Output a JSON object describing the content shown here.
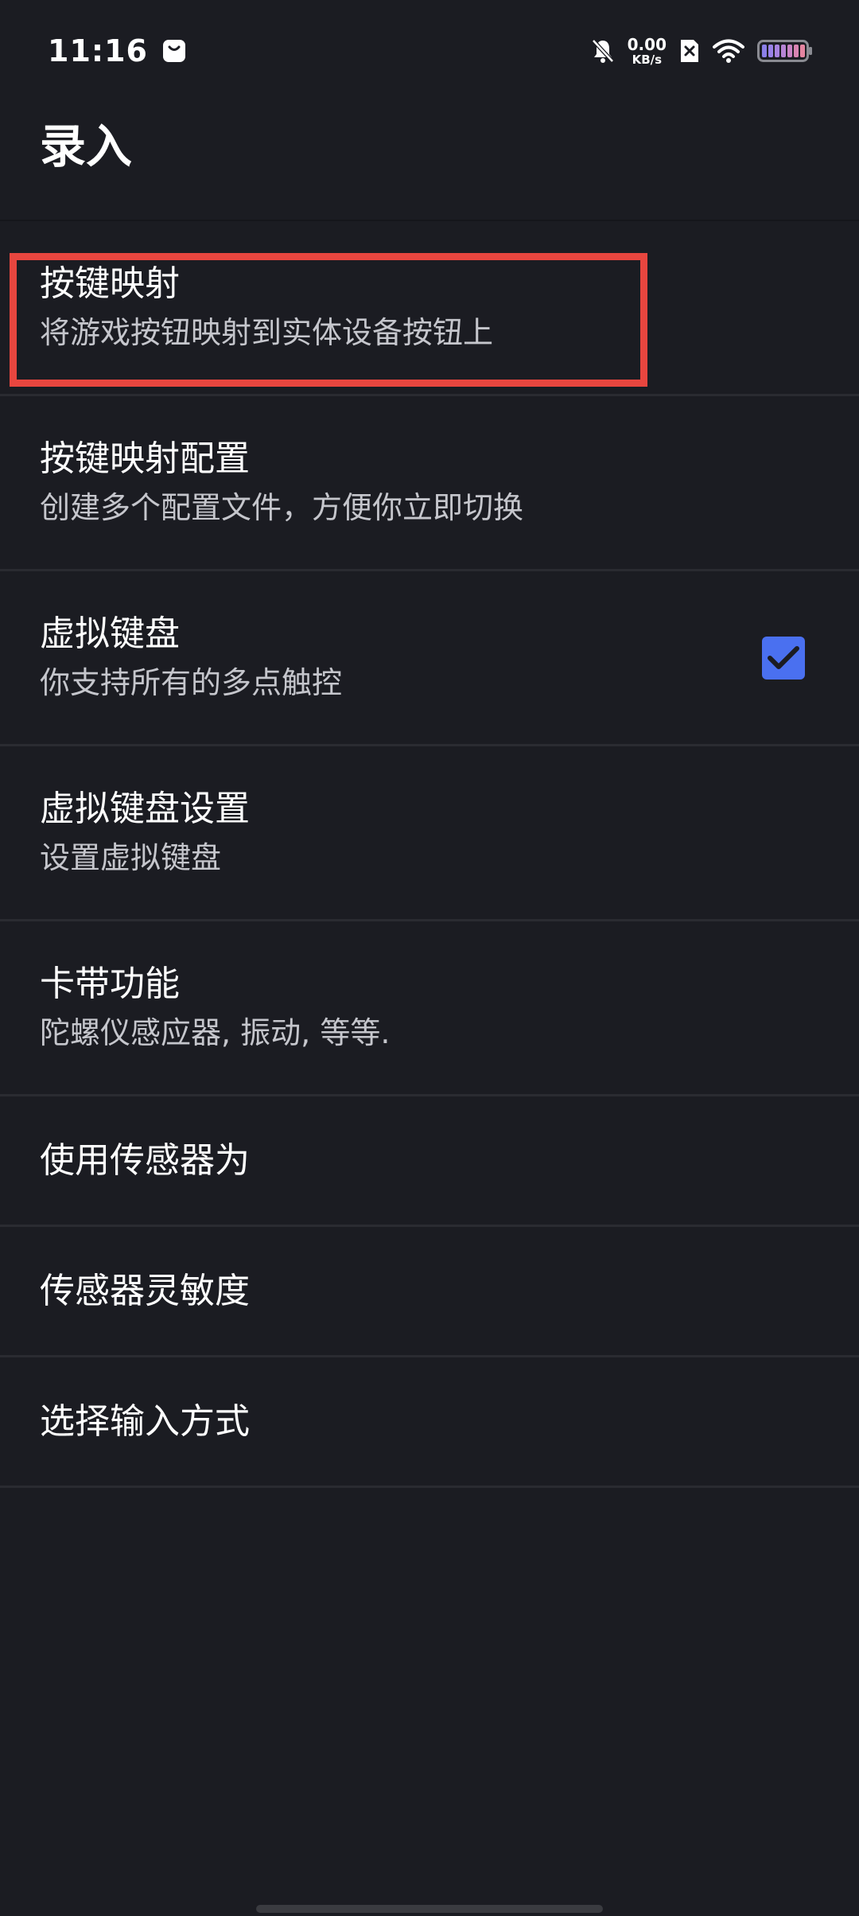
{
  "status_bar": {
    "time": "11:16",
    "net_speed_value": "0.00",
    "net_speed_unit": "KB/s",
    "icons": [
      "bag-icon",
      "bell-off-icon",
      "sim-x-icon",
      "wifi-icon",
      "battery-icon"
    ]
  },
  "header": {
    "title": "录入"
  },
  "settings": {
    "items": [
      {
        "title": "按键映射",
        "summary": "将游戏按钮映射到实体设备按钮上"
      },
      {
        "title": "按键映射配置",
        "summary": "创建多个配置文件，方便你立即切换"
      },
      {
        "title": "虚拟键盘",
        "summary": "你支持所有的多点触控",
        "checked": true
      },
      {
        "title": "虚拟键盘设置",
        "summary": "设置虚拟键盘"
      },
      {
        "title": "卡带功能",
        "summary": "陀螺仪感应器, 振动, 等等."
      },
      {
        "title": "使用传感器为"
      },
      {
        "title": "传感器灵敏度"
      },
      {
        "title": "选择输入方式"
      }
    ]
  },
  "colors": {
    "background": "#1b1c22",
    "accent": "#4a70f0",
    "highlight": "#e8463f"
  }
}
